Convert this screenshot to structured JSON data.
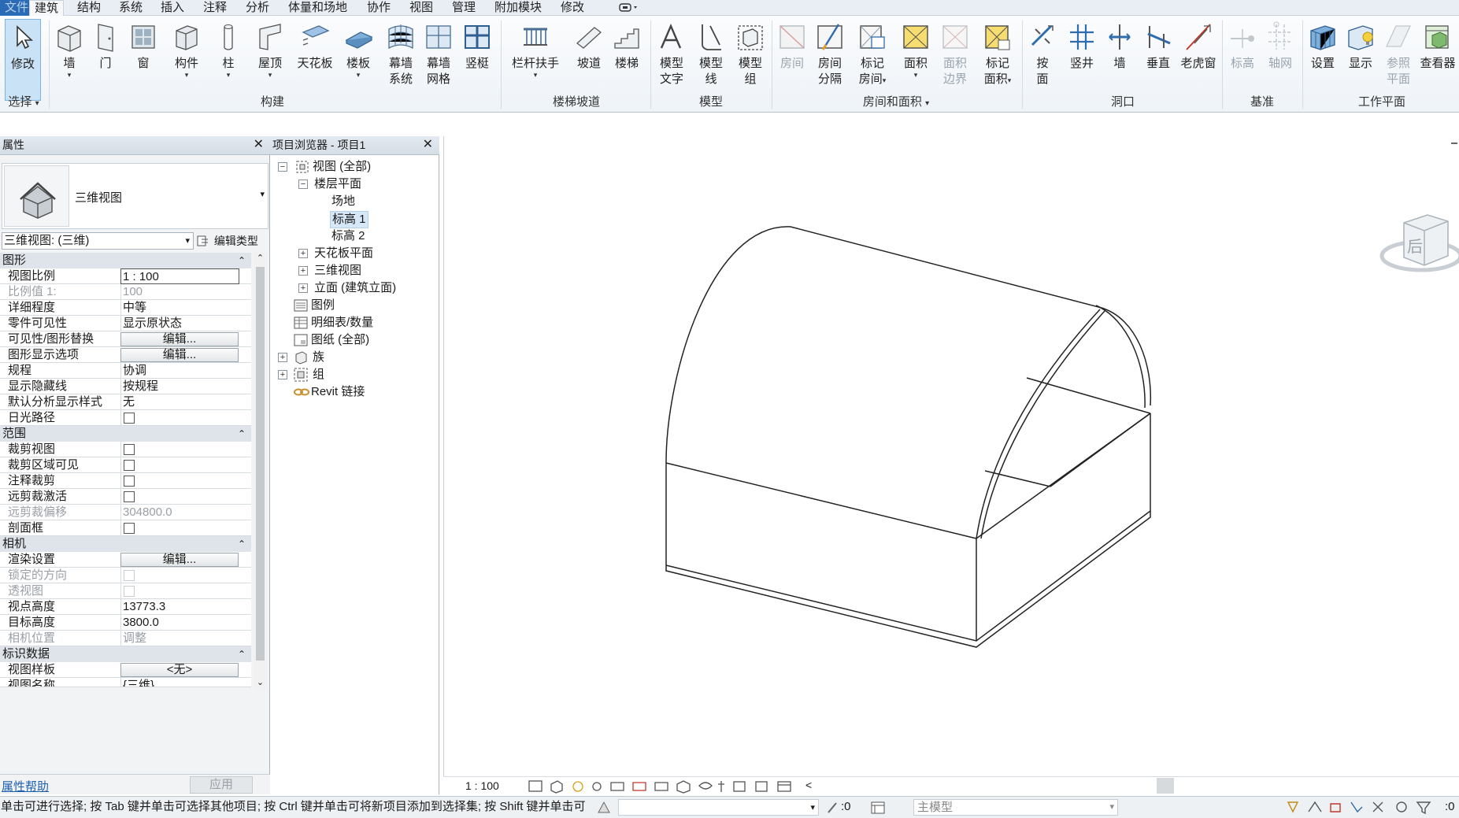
{
  "tabs": [
    "文件",
    "建筑",
    "结构",
    "系统",
    "插入",
    "注释",
    "分析",
    "体量和场地",
    "协作",
    "视图",
    "管理",
    "附加模块",
    "修改"
  ],
  "active_tab": "建筑",
  "ribbon": {
    "select": {
      "modify": "修改",
      "panel": "选择"
    },
    "build": {
      "wall": "墙",
      "door": "门",
      "window": "窗",
      "component": "构件",
      "column": "柱",
      "roof": "屋顶",
      "ceiling": "天花板",
      "floor": "楼板",
      "curtain_system_1": "幕墙",
      "curtain_system_2": "系统",
      "curtain_grid_1": "幕墙",
      "curtain_grid_2": "网格",
      "mullion": "竖梃",
      "panel": "构建"
    },
    "stairs": {
      "railing": "栏杆扶手",
      "ramp": "坡道",
      "stair": "楼梯",
      "panel": "楼梯坡道"
    },
    "model": {
      "text_1": "模型",
      "text_2": "文字",
      "line_1": "模型",
      "line_2": "线",
      "group_1": "模型",
      "group_2": "组",
      "panel": "模型"
    },
    "room": {
      "room": "房间",
      "sep_1": "房间",
      "sep_2": "分隔",
      "tag_1": "标记",
      "tag_2": "房间",
      "area": "面积",
      "area_b_1": "面积",
      "area_b_2": "边界",
      "tag_area_1": "标记",
      "tag_area_2": "面积",
      "panel": "房间和面积"
    },
    "opening": {
      "by_face_1": "按",
      "by_face_2": "面",
      "shaft": "竖井",
      "wall": "墙",
      "vertical": "垂直",
      "dormer": "老虎窗",
      "panel": "洞口"
    },
    "datum": {
      "level": "标高",
      "grid": "轴网",
      "panel": "基准"
    },
    "workplane": {
      "set": "设置",
      "show": "显示",
      "ref_1": "参照",
      "ref_2": "平面",
      "viewer": "查看器",
      "panel": "工作平面"
    }
  },
  "properties": {
    "title": "属性",
    "type_name": "三维视图",
    "view_selector": "三维视图: (三维)",
    "edit_type": "编辑类型",
    "categories": {
      "graphics": "图形",
      "extents": "范围",
      "camera": "相机",
      "identity": "标识数据"
    },
    "rows": {
      "scale_k": "视图比例",
      "scale_v": "1 : 100",
      "scale_val_k": "比例值 1:",
      "scale_val_v": "100",
      "detail_k": "详细程度",
      "detail_v": "中等",
      "parts_k": "零件可见性",
      "parts_v": "显示原状态",
      "vg_k": "可见性/图形替换",
      "vg_v": "编辑...",
      "gdo_k": "图形显示选项",
      "gdo_v": "编辑...",
      "disc_k": "规程",
      "disc_v": "协调",
      "hidden_k": "显示隐藏线",
      "hidden_v": "按规程",
      "analysis_k": "默认分析显示样式",
      "analysis_v": "无",
      "sunpath_k": "日光路径",
      "crop_k": "裁剪视图",
      "cropvis_k": "裁剪区域可见",
      "anncrop_k": "注释裁剪",
      "farclip_k": "远剪裁激活",
      "faroff_k": "远剪裁偏移",
      "faroff_v": "304800.0",
      "section_k": "剖面框",
      "render_k": "渲染设置",
      "render_v": "编辑...",
      "lock_k": "锁定的方向",
      "persp_k": "透视图",
      "eye_k": "视点高度",
      "eye_v": "13773.3",
      "target_k": "目标高度",
      "target_v": "3800.0",
      "campos_k": "相机位置",
      "campos_v": "调整",
      "template_k": "视图样板",
      "template_v": "<无>",
      "viewname_k": "视图名称",
      "viewname_v": "{三维}"
    },
    "help": "属性帮助",
    "apply": "应用"
  },
  "browser": {
    "title": "项目浏览器 - 项目1",
    "nodes": {
      "views": "视图 (全部)",
      "floor_plans": "楼层平面",
      "site": "场地",
      "level1": "标高 1",
      "level2": "标高 2",
      "ceiling_plans": "天花板平面",
      "views_3d": "三维视图",
      "elevations": "立面 (建筑立面)",
      "legends": "图例",
      "schedules": "明细表/数量",
      "sheets": "图纸 (全部)",
      "families": "族",
      "groups": "组",
      "links": "Revit 链接"
    }
  },
  "viewcube": {
    "face": "后"
  },
  "viewbar": {
    "scale": "1 : 100",
    "chevron": "<"
  },
  "status": {
    "hint": "单击可进行选择; 按 Tab 键并单击可选择其他项目; 按 Ctrl 键并单击可将新项目添加到选择集; 按 Shift 键并单击可",
    "count": ":0",
    "model": "主模型",
    "filter": ":0"
  },
  "colors": {
    "accent": "#2b6ab5",
    "selection": "#c9e2f6",
    "panel_header": "#d5dde6"
  }
}
